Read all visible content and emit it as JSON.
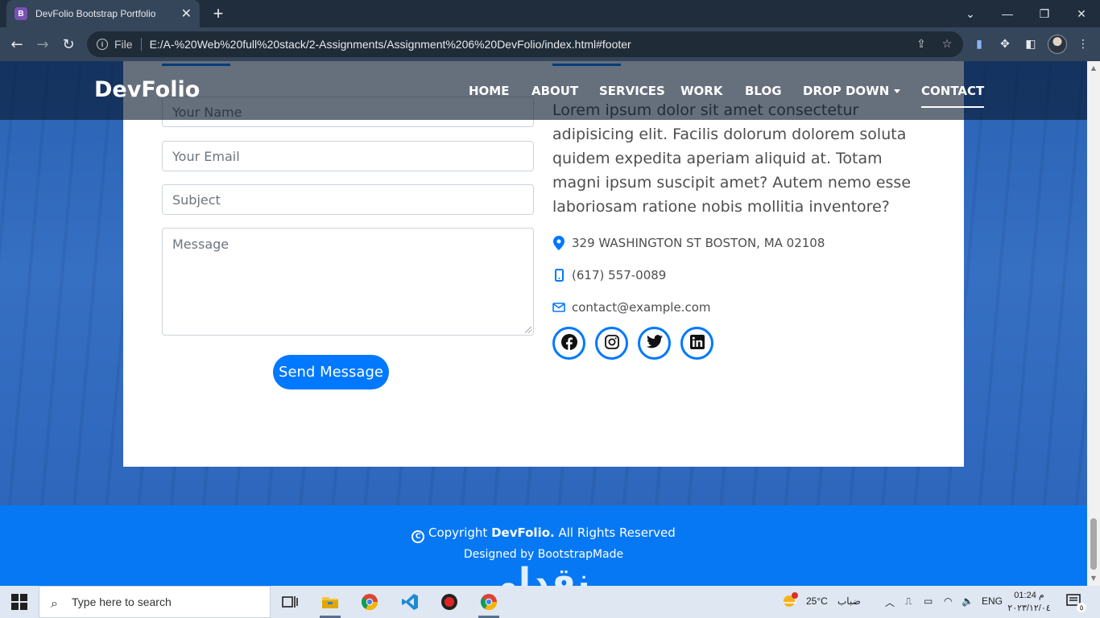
{
  "browser": {
    "tab_title": "DevFolio Bootstrap Portfolio",
    "tab_favicon": "B",
    "file_label": "File",
    "url": "E:/A-%20Web%20full%20stack/2-Assignments/Assignment%206%20DevFolio/index.html#footer"
  },
  "site": {
    "logo": "DevFolio",
    "nav": [
      {
        "label": "HOME"
      },
      {
        "label": "ABOUT"
      },
      {
        "label": "SERVICES"
      },
      {
        "label": "WORK"
      },
      {
        "label": "BLOG"
      },
      {
        "label": "DROP DOWN"
      },
      {
        "label": "CONTACT",
        "active": true
      }
    ]
  },
  "contact_form": {
    "name_placeholder": "Your Name",
    "email_placeholder": "Your Email",
    "subject_placeholder": "Subject",
    "message_placeholder": "Message",
    "submit_label": "Send Message"
  },
  "contact_info": {
    "description": "Lorem ipsum dolor sit amet consectetur adipisicing elit. Facilis dolorum dolorem soluta quidem expedita aperiam aliquid at. Totam magni ipsum suscipit amet? Autem nemo esse laboriosam ratione nobis mollitia inventore?",
    "address": "329 WASHINGTON ST BOSTON, MA 02108",
    "phone": "(617) 557-0089",
    "email": "contact@example.com",
    "social_icons": [
      "facebook-icon",
      "instagram-icon",
      "twitter-icon",
      "linkedin-icon"
    ]
  },
  "footer": {
    "copyright_prefix": "Copyright",
    "brand": "DevFolio.",
    "copyright_suffix": "All Rights Reserved",
    "designed_by": "Designed by BootstrapMade",
    "watermark": "نقدلي"
  },
  "taskbar": {
    "search_placeholder": "Type here to search",
    "weather_temp": "25°C",
    "weather_text": "ضباب",
    "language": "ENG",
    "time": "01:24 م",
    "date": "٢٠٢٣/١٢/٠٤",
    "notification_count": "٥"
  },
  "colors": {
    "accent": "#0078ff",
    "footer_bg": "#0678f4",
    "tab_bar": "#1f2d3d"
  }
}
